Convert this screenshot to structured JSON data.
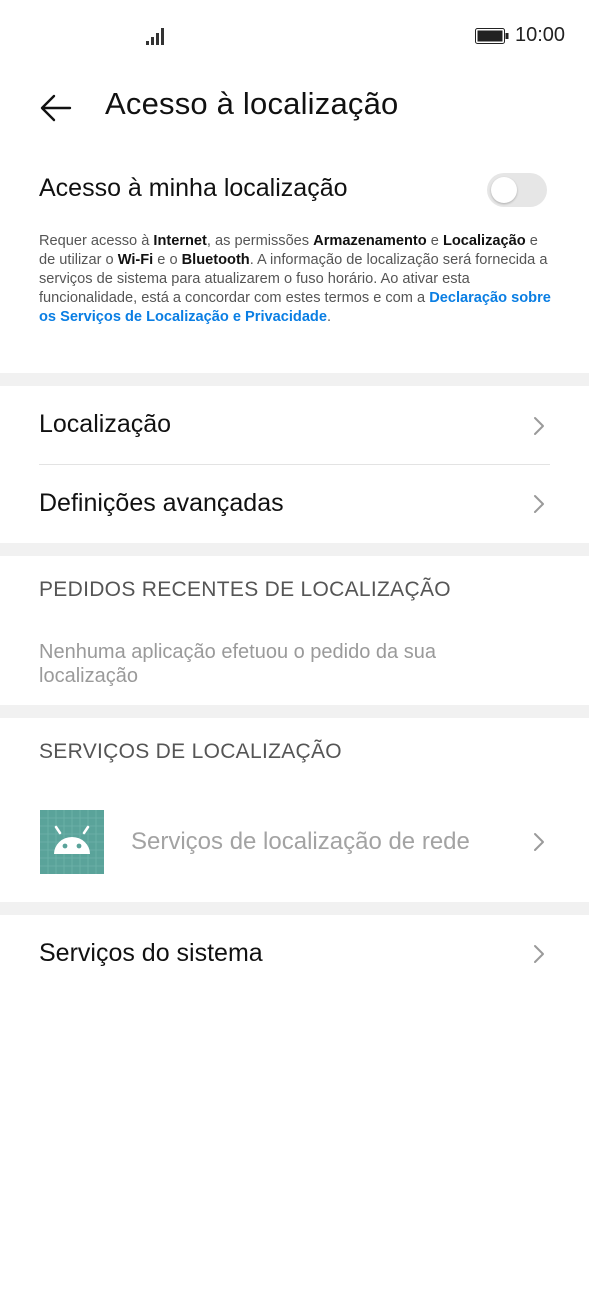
{
  "status_bar": {
    "time": "10:00"
  },
  "header": {
    "title": "Acesso à localização"
  },
  "location_access": {
    "label": "Acesso à minha localização",
    "enabled": false
  },
  "description": {
    "t1": "Requer acesso à ",
    "b1": "Internet",
    "t2": ", as permissões ",
    "b2": "Armazenamento",
    "t3": " e ",
    "b3": "Localização",
    "t4": " e de utilizar o ",
    "b4": "Wi-Fi",
    "t5": " e o ",
    "b5": "Bluetooth",
    "t6": ". A informação de localização será fornecida a serviços de sistema para atualizarem o fuso horário. Ao ativar esta funcionalidade, está a concordar com estes termos e com a ",
    "link": "Declaração sobre os Serviços de Localização e Privacidade",
    "t7": "."
  },
  "menu": {
    "location": "Localização",
    "advanced": "Definições avançadas"
  },
  "recent_requests": {
    "header": "PEDIDOS RECENTES DE LOCALIZAÇÃO",
    "empty": "Nenhuma aplicação efetuou o pedido da sua localização"
  },
  "location_services": {
    "header": "SERVIÇOS DE LOCALIZAÇÃO",
    "items": [
      {
        "label": "Serviços de localização de rede",
        "icon": "android-icon",
        "enabled": false
      }
    ]
  },
  "system_services": {
    "label": "Serviços do sistema"
  },
  "colors": {
    "accent_link": "#0a7ee3",
    "app_icon_bg": "#5aa39a",
    "section_band": "#f1f1f1"
  }
}
